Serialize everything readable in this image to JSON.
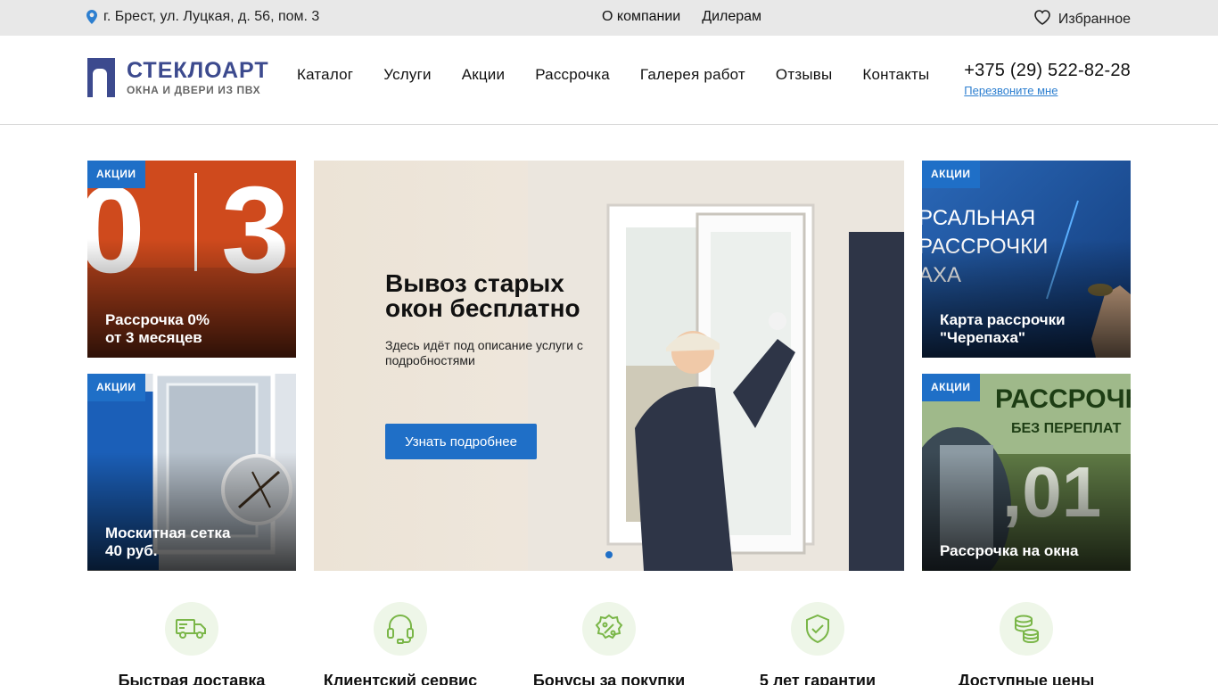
{
  "topbar": {
    "address": "г. Брест, ул. Луцкая, д. 56, пом. 3",
    "links": [
      "О компании",
      "Дилерам"
    ],
    "favorites": "Избранное"
  },
  "header": {
    "logo_name": "СТЕКЛОАРТ",
    "logo_tagline": "ОКНА И ДВЕРИ ИЗ ПВХ",
    "nav": [
      "Каталог",
      "Услуги",
      "Акции",
      "Рассрочка",
      "Галерея работ",
      "Отзывы",
      "Контакты"
    ],
    "phone": "+375 (29) 522-82-28",
    "callback": "Перезвоните мне"
  },
  "promos": [
    {
      "badge": "АКЦИИ",
      "line1": "Рассрочка 0%",
      "line2": "от 3 месяцев"
    },
    {
      "badge": "АКЦИИ",
      "line1": "Москитная сетка",
      "line2": "40 руб."
    },
    {
      "badge": "АКЦИИ",
      "line1": "Карта рассрочки",
      "line2": "\"Черепаха\""
    },
    {
      "badge": "АКЦИИ",
      "line1": "Рассрочка на окна",
      "line2": ""
    }
  ],
  "hero": {
    "title_line1": "Вывоз старых",
    "title_line2": "окон бесплатно",
    "description": "Здесь идёт под описание услуги с подробностями",
    "button": "Узнать подробнее"
  },
  "features": [
    {
      "title": "Быстрая доставка",
      "icon": "truck-icon"
    },
    {
      "title": "Клиентский сервис",
      "icon": "headset-icon"
    },
    {
      "title": "Бонусы за покупки",
      "icon": "percent-badge-icon"
    },
    {
      "title": "5 лет гарантии",
      "icon": "shield-check-icon"
    },
    {
      "title": "Доступные цены",
      "icon": "coins-icon"
    }
  ],
  "colors": {
    "accent": "#1f6fc7",
    "brand": "#3c4a8e",
    "icon_green": "#7ab648"
  }
}
